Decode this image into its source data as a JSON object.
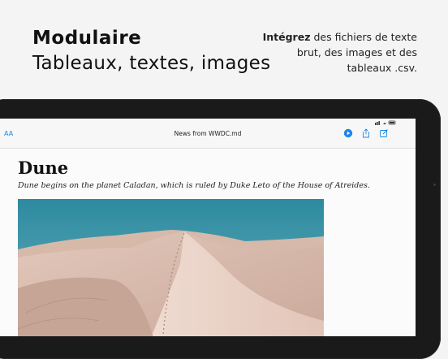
{
  "promo": {
    "title": "Modulaire",
    "subtitle": "Tableaux, textes, images",
    "blurb_bold": "Intégrez",
    "blurb_rest": " des fichiers de texte brut, des images et des tableaux .csv."
  },
  "app": {
    "font_button": "AA",
    "document_title": "News from WWDC.md",
    "accent_color": "#1e88e5",
    "status_icons": "wifi-battery"
  },
  "document": {
    "heading": "Dune",
    "lead": "Dune begins on the planet Caladan, which is ruled by Duke Leto of the House of Atreides.",
    "image": "desert-dunes-photo"
  }
}
